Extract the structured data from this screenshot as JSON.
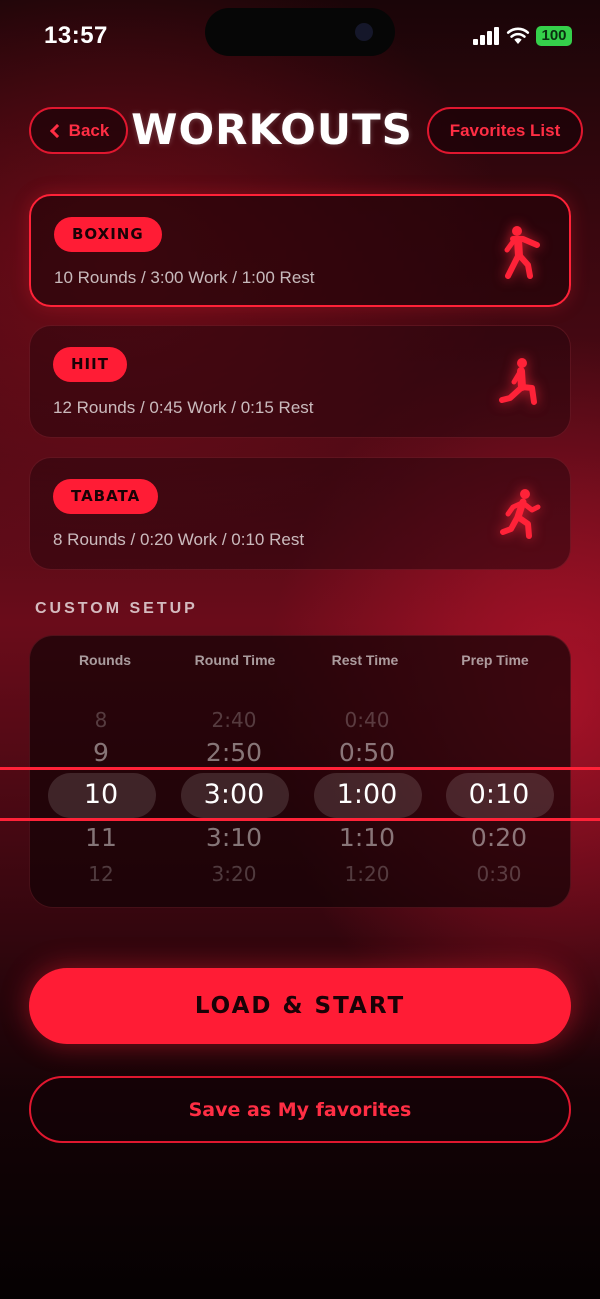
{
  "status_bar": {
    "time": "13:57",
    "battery": "100",
    "signal_icon": "cellular-signal-icon",
    "wifi_icon": "wifi-icon"
  },
  "header": {
    "back_label": "Back",
    "title": "WORKOUTS",
    "favorites_label": "Favorites List"
  },
  "workouts": [
    {
      "tag": "BOXING",
      "details": "10 Rounds / 3:00 Work / 1:00 Rest",
      "icon": "boxing-figure-icon",
      "selected": true
    },
    {
      "tag": "HIIT",
      "details": "12 Rounds / 0:45 Work / 0:15 Rest",
      "icon": "lunge-figure-icon",
      "selected": false
    },
    {
      "tag": "TABATA",
      "details": "8 Rounds / 0:20 Work / 0:10 Rest",
      "icon": "running-figure-icon",
      "selected": false
    }
  ],
  "custom_setup": {
    "title": "CUSTOM SETUP",
    "columns": [
      {
        "label": "Rounds",
        "values": [
          "8",
          "9",
          "10",
          "11",
          "12"
        ]
      },
      {
        "label": "Round Time",
        "values": [
          "2:40",
          "2:50",
          "3:00",
          "3:10",
          "3:20"
        ]
      },
      {
        "label": "Rest Time",
        "values": [
          "0:40",
          "0:50",
          "1:00",
          "1:10",
          "1:20"
        ]
      },
      {
        "label": "Prep Time",
        "values": [
          "",
          "",
          "0:10",
          "0:20",
          "0:30"
        ]
      }
    ]
  },
  "actions": {
    "start_label": "LOAD & START",
    "save_label": "Save as My favorites"
  },
  "colors": {
    "accent": "#ff1c35",
    "background_dark": "#1a0508"
  }
}
